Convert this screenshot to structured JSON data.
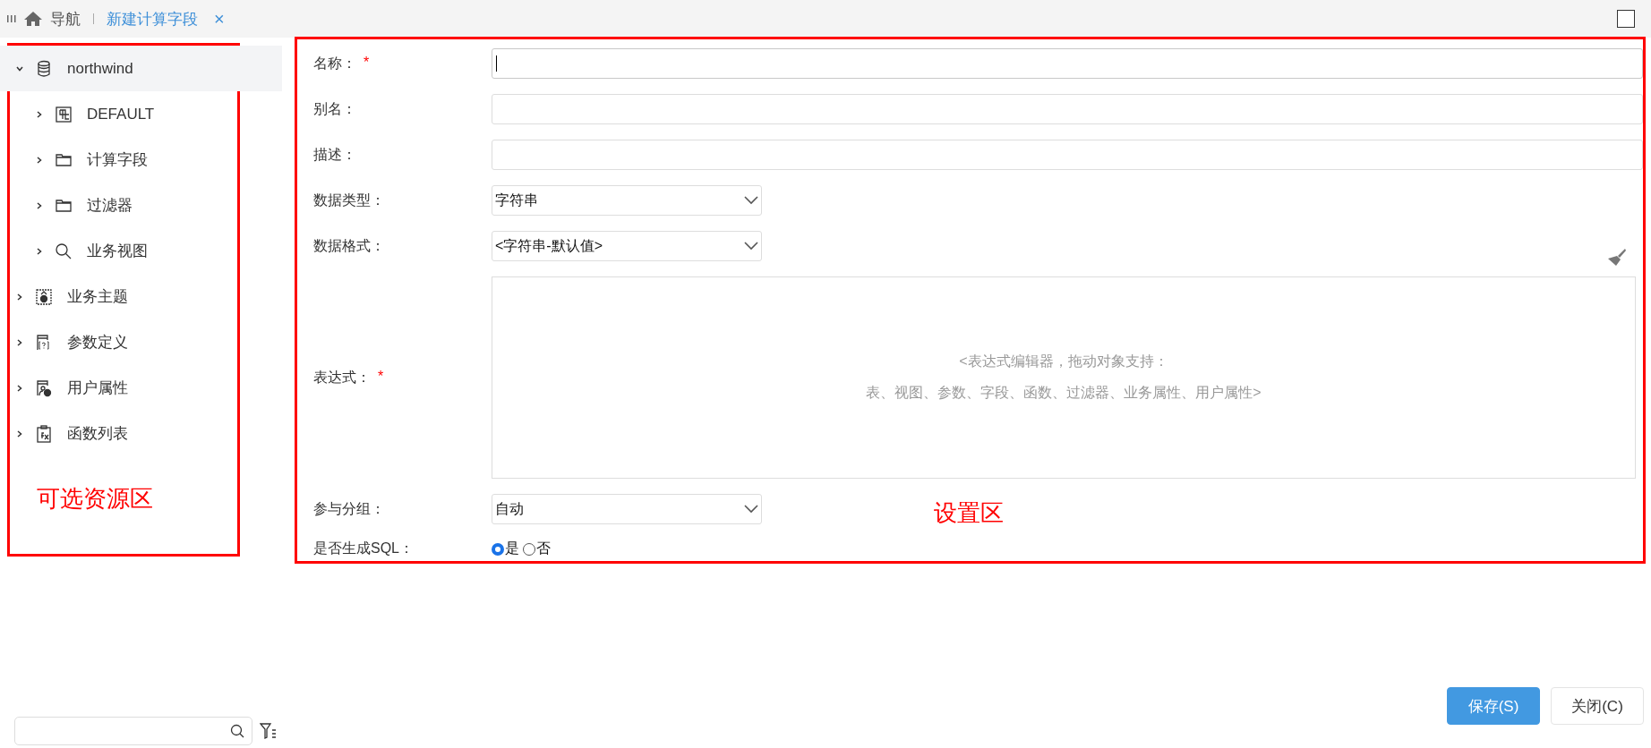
{
  "tabs": [
    {
      "label": "导航",
      "kind": "home",
      "selected": false
    },
    {
      "label": "新建计算字段",
      "kind": "doc",
      "selected": true,
      "close": "×"
    }
  ],
  "resource_panel": {
    "annotation": "可选资源区",
    "tree": [
      {
        "label": "northwind",
        "kind": "database",
        "expanded": true,
        "selected": true,
        "children": [
          {
            "label": "DEFAULT",
            "kind": "table",
            "expanded": false,
            "selected": false
          },
          {
            "label": "计算字段",
            "kind": "folder",
            "expanded": false,
            "selected": false
          },
          {
            "label": "过滤器",
            "kind": "folder",
            "expanded": false,
            "selected": false
          },
          {
            "label": "业务视图",
            "kind": "search",
            "expanded": false,
            "selected": false
          }
        ]
      },
      {
        "label": "业务主题",
        "kind": "subject",
        "expanded": false,
        "selected": false
      },
      {
        "label": "参数定义",
        "kind": "param",
        "expanded": false,
        "selected": false
      },
      {
        "label": "用户属性",
        "kind": "user",
        "expanded": false,
        "selected": false
      },
      {
        "label": "函数列表",
        "kind": "function",
        "expanded": false,
        "selected": false
      }
    ]
  },
  "settings_panel": {
    "annotation": "设置区",
    "fields": [
      {
        "label": "名称：",
        "required_mark": "*",
        "kind": "text",
        "focused": true
      },
      {
        "label": "别名：",
        "kind": "text",
        "focused": false
      },
      {
        "label": "描述：",
        "kind": "text",
        "focused": false
      },
      {
        "label": "数据类型：",
        "kind": "select",
        "value": "字符串"
      },
      {
        "label": "数据格式：",
        "kind": "select",
        "value": "<字符串-默认值>",
        "tool": true
      },
      {
        "label": "表达式：",
        "required_mark": "*",
        "kind": "editor",
        "placeholder_lines": [
          "<表达式编辑器，拖动对象支持：",
          "表、视图、参数、字段、函数、过滤器、业务属性、用户属性>"
        ]
      },
      {
        "label": "参与分组：",
        "kind": "select",
        "value": "自动"
      },
      {
        "label": "是否生成SQL：",
        "kind": "radio",
        "options": [
          {
            "label": "是",
            "selected": true
          },
          {
            "label": "否",
            "selected": false
          }
        ]
      }
    ]
  },
  "buttons": [
    {
      "label": "保存(S)",
      "primary": true
    },
    {
      "label": "关闭(C)",
      "primary": false
    }
  ]
}
